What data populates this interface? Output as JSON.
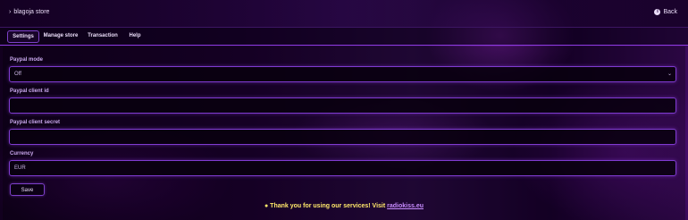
{
  "header": {
    "brand_prefix": "›",
    "brand_name": "blagoja store",
    "back_icon": "info-circle-icon",
    "back_label": "Back"
  },
  "tabs": [
    {
      "label": "Settings",
      "active": true
    },
    {
      "label": "Manage store",
      "active": false
    },
    {
      "label": "Transaction",
      "active": false
    },
    {
      "label": "Help",
      "active": false
    }
  ],
  "form": {
    "paypal_mode": {
      "label": "Paypal mode",
      "value": "Off"
    },
    "client_id": {
      "label": "Paypal client id",
      "value": ""
    },
    "client_secret": {
      "label": "Paypal client secret",
      "value": ""
    },
    "currency": {
      "label": "Currency",
      "value": "EUR"
    },
    "save_label": "Save"
  },
  "footer": {
    "icon": "speech-bubble-icon",
    "text": "Thank you for using our services! Visit",
    "link_text": "radiokiss.eu"
  }
}
